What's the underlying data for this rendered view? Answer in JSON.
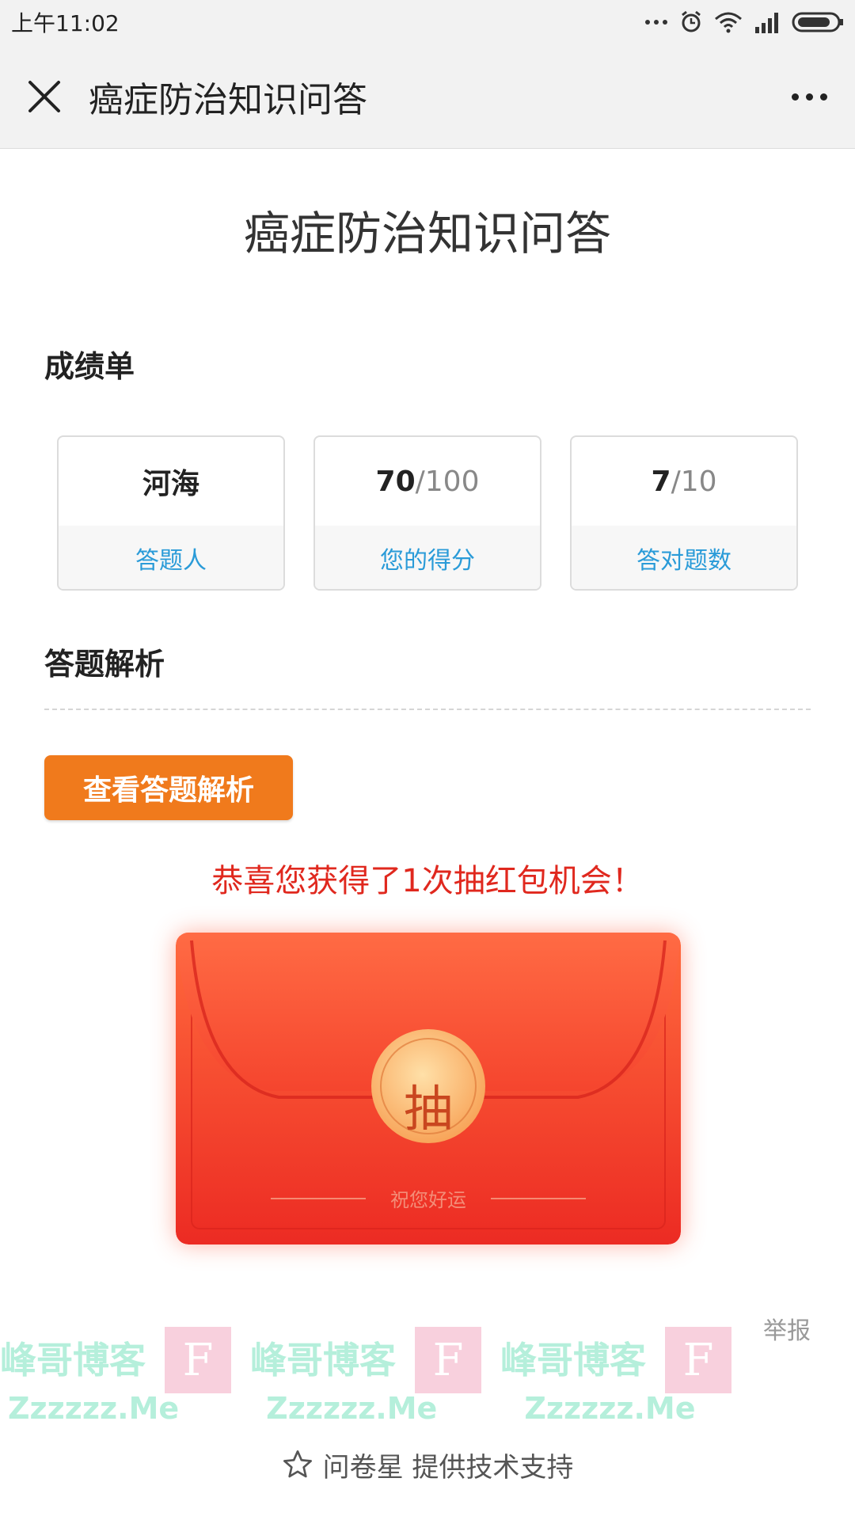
{
  "status_bar": {
    "time": "上午11:02"
  },
  "nav": {
    "title": "癌症防治知识问答"
  },
  "page": {
    "title": "癌症防治知识问答"
  },
  "scorecard": {
    "section_title": "成绩单",
    "respondent": {
      "name": "河海",
      "label": "答题人"
    },
    "score": {
      "value": "70",
      "total": "/100",
      "label": "您的得分"
    },
    "correct": {
      "value": "7",
      "total": "/10",
      "label": "答对题数"
    }
  },
  "analysis": {
    "section_title": "答题解析",
    "button_label": "查看答题解析"
  },
  "prize": {
    "message": "恭喜您获得了1次抽红包机会！",
    "envelope_button": "抽",
    "blessing": "祝您好运"
  },
  "report_label": "举报",
  "footer": {
    "text": "问卷星 提供技术支持"
  },
  "watermark": {
    "brand": "峰哥博客",
    "site": "Zzzzzz.Me",
    "logo_letter": "F"
  },
  "colors": {
    "accent_orange": "#f07a1c",
    "label_blue": "#2a9bd8",
    "red": "#e0281e"
  }
}
